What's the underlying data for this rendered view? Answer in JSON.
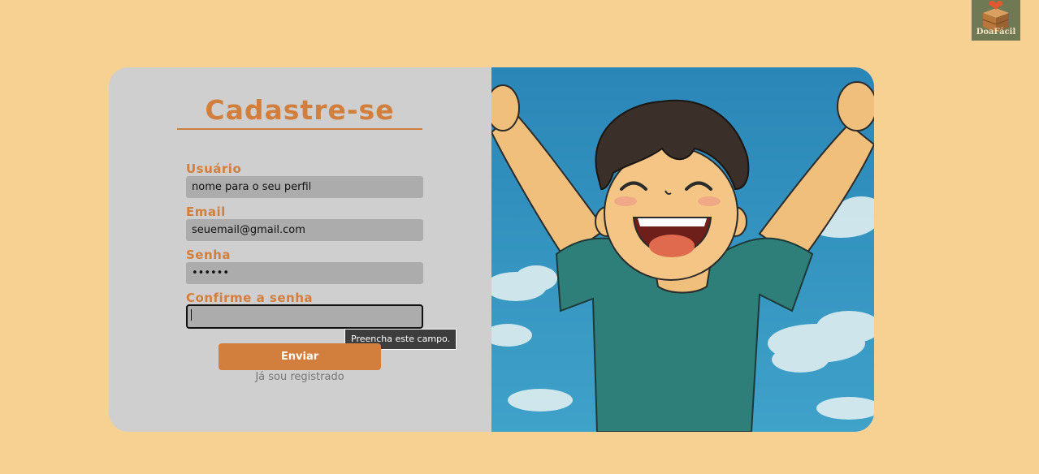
{
  "logo": {
    "text": "DoaFácil"
  },
  "form": {
    "title": "Cadastre-se",
    "fields": [
      {
        "label": "Usuário",
        "placeholder": "nome para o seu perfil",
        "value": ""
      },
      {
        "label": "Email",
        "placeholder": "seuemail@gmail.com",
        "value": ""
      },
      {
        "label": "Senha",
        "placeholder": "••••••",
        "value": ""
      },
      {
        "label": "Confirme a senha",
        "placeholder": "",
        "value": ""
      }
    ],
    "validation_tooltip": "Preencha este campo.",
    "submit_label": "Enviar",
    "login_link": "Já sou registrado"
  },
  "illustration": {
    "icon": "happy-boy-illustration"
  },
  "colors": {
    "background": "#f7d191",
    "accent": "#d27f3d",
    "panel": "#cfcfcf",
    "input": "#acacac",
    "sky": "#2f8fbd"
  }
}
